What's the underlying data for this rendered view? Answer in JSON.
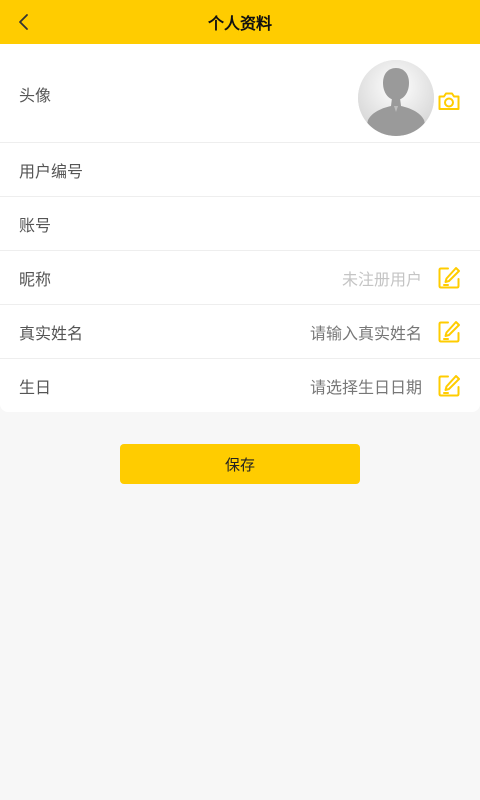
{
  "header": {
    "title": "个人资料",
    "back_icon": "chevron-left-icon"
  },
  "profile": {
    "avatar": {
      "label": "头像",
      "camera_icon": "camera-icon"
    },
    "user_number": {
      "label": "用户编号",
      "value": ""
    },
    "account": {
      "label": "账号",
      "value": ""
    },
    "nickname": {
      "label": "昵称",
      "value": "未注册用户",
      "edit_icon": "edit-icon"
    },
    "real_name": {
      "label": "真实姓名",
      "placeholder": "请输入真实姓名",
      "edit_icon": "edit-icon"
    },
    "birthday": {
      "label": "生日",
      "placeholder": "请选择生日日期",
      "edit_icon": "edit-icon"
    }
  },
  "actions": {
    "save_label": "保存"
  },
  "colors": {
    "accent": "#ffcc00",
    "background": "#f7f7f7",
    "card": "#ffffff"
  }
}
